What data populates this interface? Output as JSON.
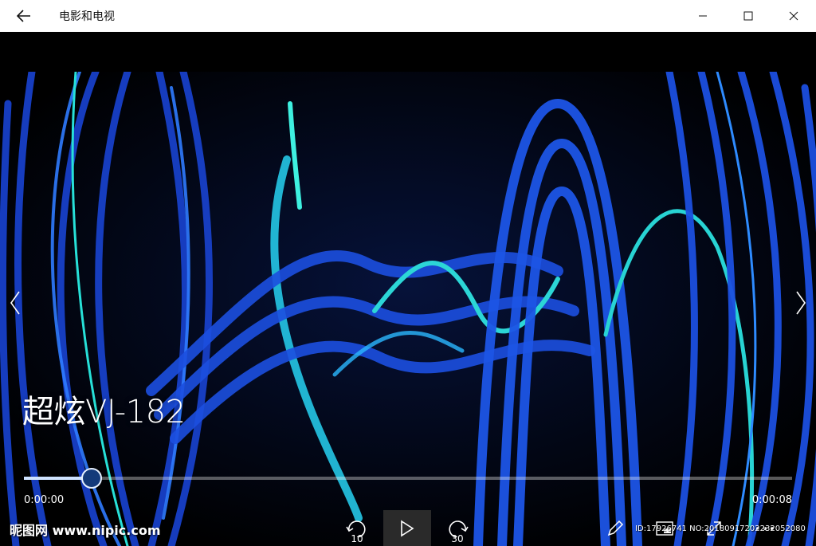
{
  "app": {
    "title": "电影和电视"
  },
  "video": {
    "title": "超炫VJ-182",
    "current_time": "0:00:00",
    "end_time": "0:00:08",
    "progress": 0.088
  },
  "controls": {
    "rewind_label": "10",
    "forward_label": "30"
  },
  "watermark": {
    "site": "昵图网 www.nipic.com",
    "id": "ID:17926741 NO:20180917202232052080"
  },
  "colors": {
    "accent": "#cfe3ff",
    "ribbon_blue": "#1a4fd6",
    "ribbon_cyan": "#22d6e0"
  }
}
